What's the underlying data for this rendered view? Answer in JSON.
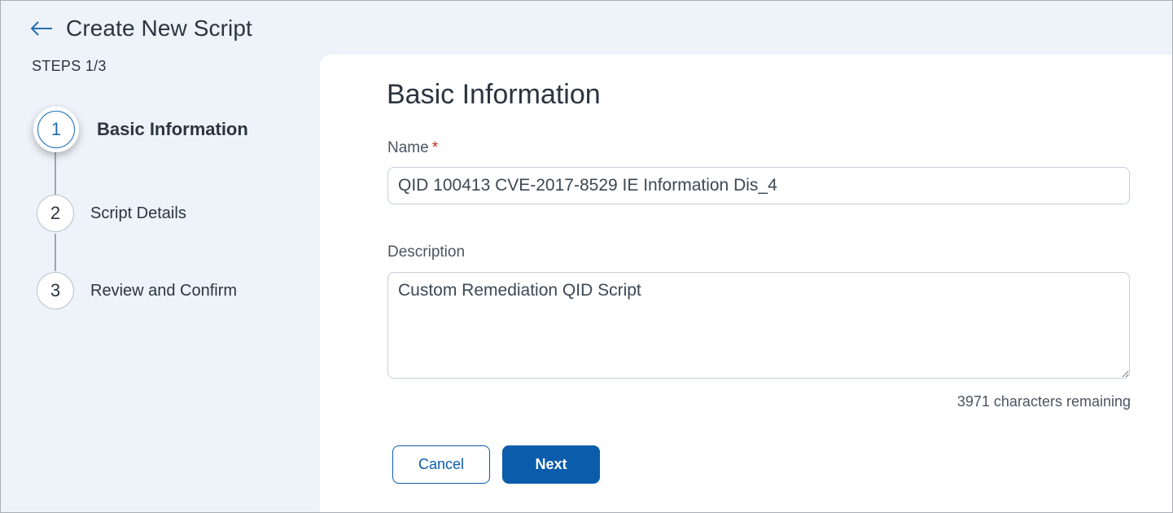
{
  "header": {
    "title": "Create New Script",
    "back_icon": "arrow-left-icon"
  },
  "stepper": {
    "progress_label": "STEPS 1/3",
    "current_step": 1,
    "total_steps": 3,
    "steps": [
      {
        "number": "1",
        "label": "Basic Information",
        "active": true
      },
      {
        "number": "2",
        "label": "Script Details",
        "active": false
      },
      {
        "number": "3",
        "label": "Review and Confirm",
        "active": false
      }
    ]
  },
  "form": {
    "section_title": "Basic Information",
    "name": {
      "label": "Name",
      "required_marker": "*",
      "value": "QID 100413 CVE-2017-8529 IE Information Dis_4"
    },
    "description": {
      "label": "Description",
      "value": "Custom Remediation QID Script",
      "chars_remaining": "3971 characters remaining"
    }
  },
  "actions": {
    "cancel_label": "Cancel",
    "next_label": "Next"
  },
  "colors": {
    "accent": "#0b5cab",
    "required": "#d0271d",
    "background": "#eef3f9",
    "panel": "#ffffff"
  }
}
